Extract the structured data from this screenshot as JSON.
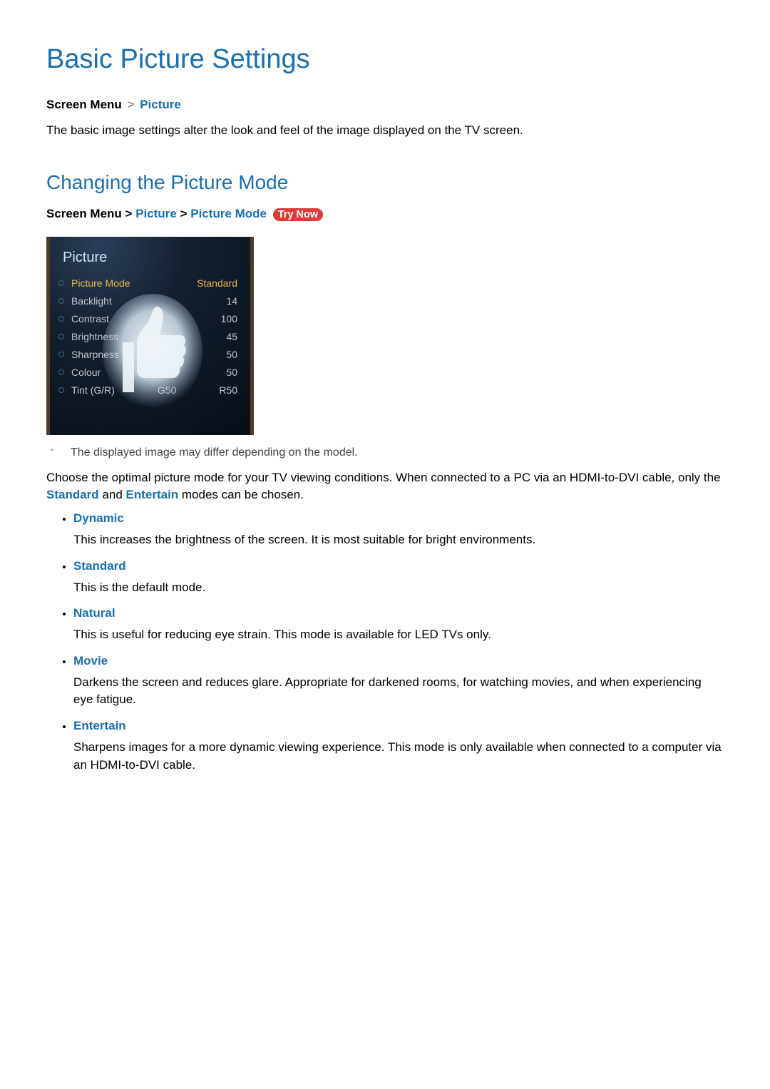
{
  "page": {
    "title": "Basic Picture Settings"
  },
  "breadcrumb1": {
    "root": "Screen Menu",
    "sep": ">",
    "leaf": "Picture"
  },
  "intro": "The basic image settings alter the look and feel of the image displayed on the TV screen.",
  "section": {
    "title": "Changing the Picture Mode"
  },
  "breadcrumb2": {
    "root": "Screen Menu",
    "sep": ">",
    "mid": "Picture",
    "leaf": "Picture Mode",
    "try_now": "Try Now"
  },
  "tv_menu": {
    "header": "Picture",
    "rows": [
      {
        "label": "Picture Mode",
        "value": "Standard",
        "selected": true
      },
      {
        "label": "Backlight",
        "value": "14"
      },
      {
        "label": "Contrast",
        "value": "100"
      },
      {
        "label": "Brightness",
        "value": "45"
      },
      {
        "label": "Sharpness",
        "value": "50"
      },
      {
        "label": "Colour",
        "value": "50"
      },
      {
        "label": "Tint (G/R)",
        "mid": "G50",
        "value": "R50"
      }
    ]
  },
  "note": {
    "mark": "\"",
    "text": "The displayed image may differ depending on the model."
  },
  "body_para": {
    "pre": "Choose the optimal picture mode for your TV viewing conditions. When connected to a PC via an HDMI-to-DVI cable, only the ",
    "link1": "Standard",
    "mid": " and ",
    "link2": "Entertain",
    "post": " modes can be chosen."
  },
  "modes": [
    {
      "name": "Dynamic",
      "desc": "This increases the brightness of the screen. It is most suitable for bright environments."
    },
    {
      "name": "Standard",
      "desc": "This is the default mode."
    },
    {
      "name": "Natural",
      "desc": "This is useful for reducing eye strain. This mode is available for LED TVs only."
    },
    {
      "name": "Movie",
      "desc": "Darkens the screen and reduces glare. Appropriate for darkened rooms, for watching movies, and when experiencing eye fatigue."
    },
    {
      "name": "Entertain",
      "desc": "Sharpens images for a more dynamic viewing experience. This mode is only available when connected to a computer via an HDMI-to-DVI cable."
    }
  ]
}
